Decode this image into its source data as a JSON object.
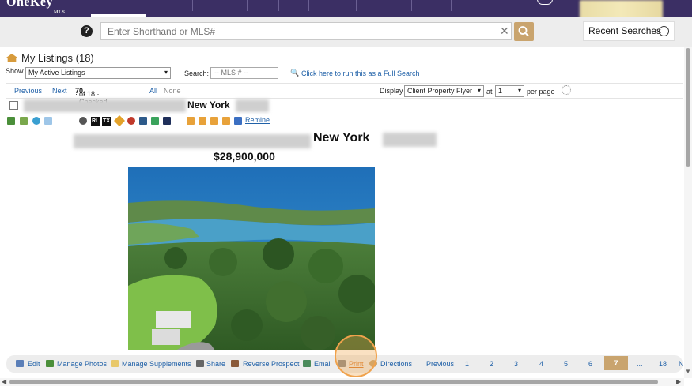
{
  "app": {
    "logo": "OneKey",
    "logo_sub": "MLS"
  },
  "search": {
    "placeholder": "Enter Shorthand or MLS#",
    "recent_label": "Recent Searches"
  },
  "listings": {
    "title": "My Listings (18)",
    "show_label": "Show",
    "show_value": "My Active Listings",
    "search_label": "Search:",
    "mls_placeholder": "-- MLS # --",
    "full_search_link": "Click here to run this as a Full Search"
  },
  "pager": {
    "previous": "Previous",
    "next": "Next",
    "count_prefix": "· ",
    "count_current": "7",
    "count_mid": " of 18 · Checked ",
    "count_checked": "0",
    "count_sep": " · ",
    "all": "All",
    "none": "None",
    "display_label": "Display",
    "display_value": "Client Property Flyer",
    "at_label": "at",
    "per_page_value": "1",
    "per_page_label": "per page"
  },
  "listing": {
    "city_small": "New York",
    "city_big": "New York",
    "price": "$28,900,000",
    "icon_labels": {
      "rl": "RL",
      "tx": "TX"
    },
    "remine": "Remine"
  },
  "actions": [
    {
      "label": "Edit",
      "icon": "edit-icon"
    },
    {
      "label": "Manage Photos",
      "icon": "photos-icon"
    },
    {
      "label": "Manage Supplements",
      "icon": "folder-icon"
    },
    {
      "label": "Share",
      "icon": "share-icon"
    },
    {
      "label": "Reverse Prospect",
      "icon": "person-icon"
    },
    {
      "label": "Email",
      "icon": "email-icon"
    },
    {
      "label": "Print",
      "icon": "printer-icon"
    },
    {
      "label": "Directions",
      "icon": "directions-icon"
    }
  ],
  "bottom_pager": {
    "previous": "Previous",
    "pages": [
      "1",
      "2",
      "3",
      "4",
      "5",
      "6"
    ],
    "active": "7",
    "ellipsis": "...",
    "last": "18",
    "next_partial": "N"
  },
  "colors": {
    "topbar": "#3b2f64",
    "accent": "#c9a46e",
    "link": "#2061a8",
    "highlight": "#f0a24c"
  }
}
